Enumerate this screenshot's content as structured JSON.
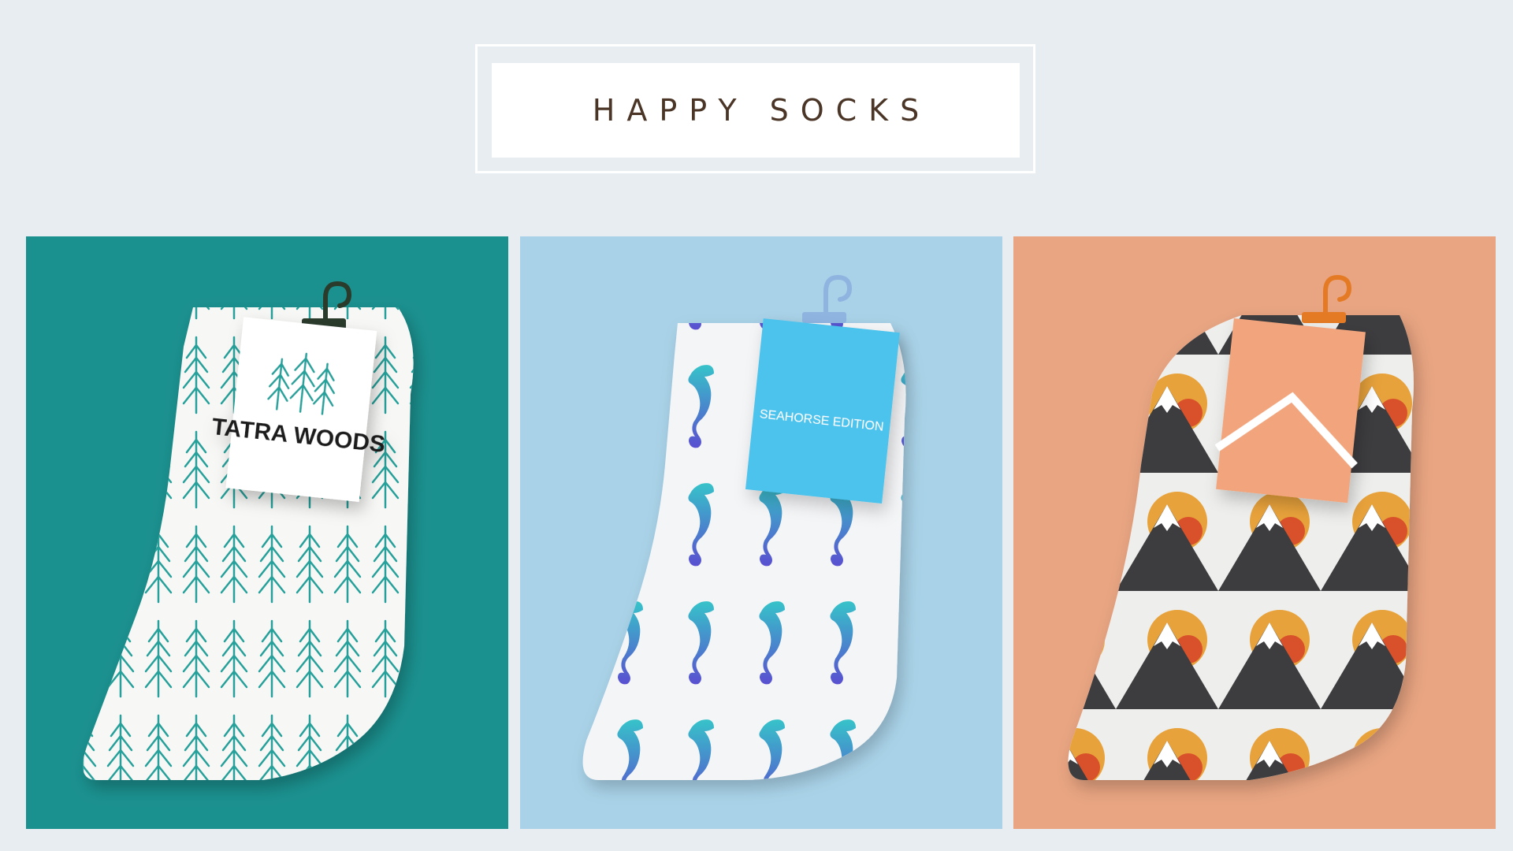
{
  "title": "HAPPY SOCKS",
  "colors": {
    "page_background": "#e7edf0",
    "title_text": "#4a3526",
    "panel_teal": "#1b918f",
    "panel_blue": "#a9d2e8",
    "panel_peach": "#e9a582"
  },
  "products": [
    {
      "tag_text": "TATRA WOODS",
      "pattern": "pine-trees",
      "hanger_color": "#2a3b2c",
      "tag_color": "#ffffff",
      "accent": "#27a09a"
    },
    {
      "tag_text": "SEAHORSE EDITION",
      "pattern": "seahorses",
      "hanger_color": "#8fb4e0",
      "tag_color": "#4cc3ec",
      "accent": "#5b5fd0"
    },
    {
      "tag_text": "",
      "pattern": "mountains-and-suns",
      "hanger_color": "#e47a24",
      "tag_color": "#f2a57b",
      "accent": "#e8a23a"
    }
  ]
}
